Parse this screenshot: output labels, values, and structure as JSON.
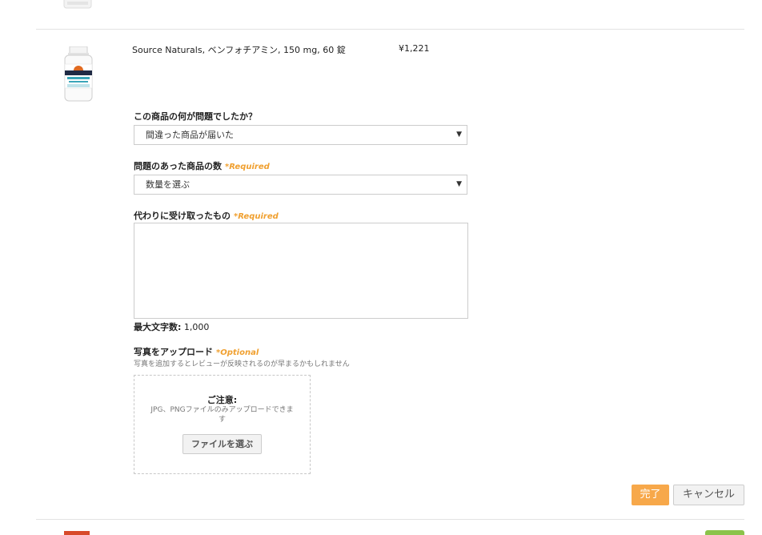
{
  "product": {
    "name": "Source Naturals, ベンフォチアミン, 150 mg, 60 錠",
    "price": "¥1,221",
    "bottle_label": "BENFOTIAMINE"
  },
  "form": {
    "problem": {
      "label": "この商品の何が問題でしたか？",
      "selected": "間違った商品が届いた"
    },
    "quantity": {
      "label": "問題のあった商品の数",
      "required": "*Required",
      "selected": "数量を選ぶ"
    },
    "received": {
      "label": "代わりに受け取ったもの",
      "required": "*Required",
      "value": ""
    },
    "max_chars": {
      "label": "最大文字数:",
      "value": "1,000"
    },
    "upload": {
      "label": "写真をアップロード",
      "optional": "*Optional",
      "hint": "写真を追加するとレビューが反映されるのが早まるかもしれません",
      "notice_title": "ご注意:",
      "notice_text": "JPG、PNGファイルのみアップロードできます",
      "choose_button": "ファイルを選ぶ"
    },
    "done_button": "完了",
    "cancel_button": "キャンセル"
  },
  "colors": {
    "accent": "#f7a84a",
    "required": "#f0a030"
  }
}
